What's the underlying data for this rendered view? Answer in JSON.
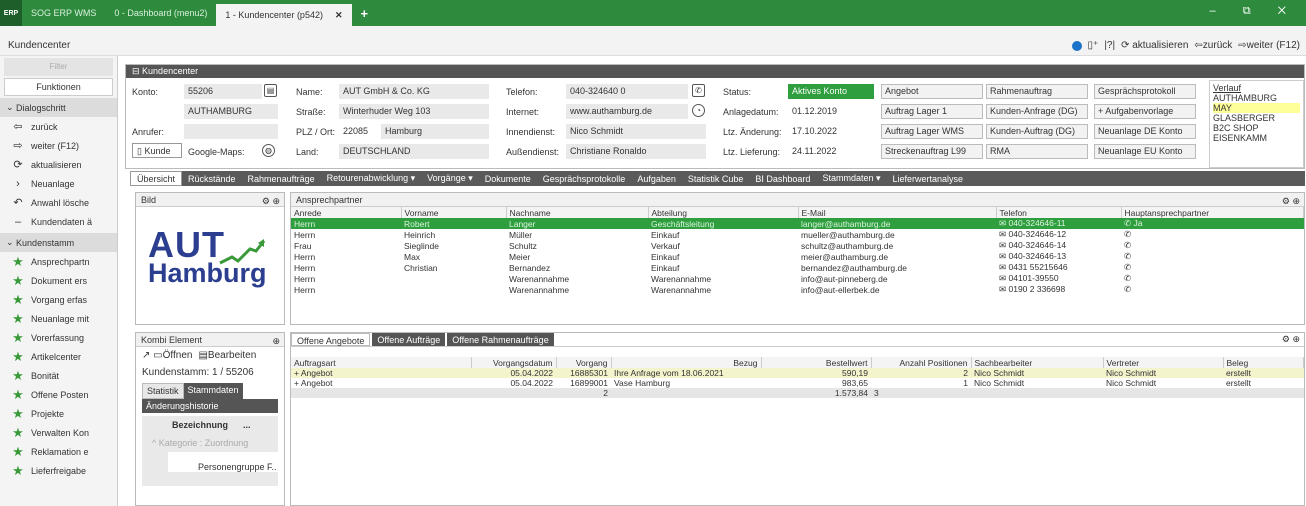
{
  "topbar": {
    "logo": "ERP",
    "tabs": [
      {
        "label": "SOG ERP WMS"
      },
      {
        "label": "0 - Dashboard (menu2)"
      }
    ],
    "active_tab": "1 - Kundencenter (p542)",
    "close": "✕",
    "plus": "+",
    "controls": "– ⧉ ✕"
  },
  "header": {
    "title": "Kundencenter",
    "refresh": "aktualisieren",
    "back": "zurück",
    "forward": "weiter (F12)"
  },
  "sidebar": {
    "filter": "Filter",
    "functions": "Funktionen",
    "sections": {
      "dialog": "Dialogschritt",
      "kunden": "Kundenstamm"
    },
    "dialog_items": [
      {
        "icon": "back-arrow-icon",
        "glyph": "⇦",
        "label": "zurück"
      },
      {
        "icon": "forward-arrow-icon",
        "glyph": "⇨",
        "label": "weiter (F12)"
      },
      {
        "icon": "refresh-icon",
        "glyph": "⟳",
        "label": "aktualisieren"
      },
      {
        "icon": "chevron-right-icon",
        "glyph": "›",
        "label": "Neuanlage"
      },
      {
        "icon": "delete-icon",
        "glyph": "↶",
        "label": "Anwahl lösche"
      },
      {
        "icon": "minus-icon",
        "glyph": "–",
        "label": "Kundendaten ä"
      }
    ],
    "kunden_items": [
      {
        "label": "Ansprechpartn"
      },
      {
        "label": "Dokument ers"
      },
      {
        "label": "Vorgang erfas"
      },
      {
        "label": "Neuanlage mit"
      },
      {
        "label": "Vorerfassung"
      },
      {
        "label": "Artikelcenter"
      },
      {
        "label": "Bonität"
      },
      {
        "label": "Offene Posten"
      },
      {
        "label": "Projekte"
      },
      {
        "label": "Verwalten Kon"
      },
      {
        "label": "Reklamation e"
      },
      {
        "label": "Lieferfreigabe"
      }
    ]
  },
  "kc": {
    "title": "Kundencenter",
    "konto_l": "Konto:",
    "konto": "55206",
    "matchcode": "AUTHAMBURG",
    "anrufer_l": "Anrufer:",
    "kunde_btn": "Kunde",
    "maps_l": "Google-Maps:",
    "name_l": "Name:",
    "name": "AUT GmbH & Co. KG",
    "strasse_l": "Straße:",
    "strasse": "Winterhuder Weg 103",
    "plz_l": "PLZ / Ort:",
    "plz": "22085",
    "ort": "Hamburg",
    "land_l": "Land:",
    "land": "DEUTSCHLAND",
    "tel_l": "Telefon:",
    "tel": "040-324640 0",
    "inet_l": "Internet:",
    "inet": "www.authamburg.de",
    "inn_l": "Innendienst:",
    "inn": "Nico Schmidt",
    "aus_l": "Außendienst:",
    "aus": "Christiane Ronaldo",
    "status_l": "Status:",
    "status": "Aktives Konto",
    "anl_l": "Anlagedatum:",
    "anl": "01.12.2019",
    "aend_l": "Ltz. Änderung:",
    "aend": "17.10.2022",
    "lief_l": "Ltz. Lieferung:",
    "lief": "24.11.2022",
    "buttons": [
      [
        "Angebot",
        "Rahmenauftrag",
        "Gesprächsprotokoll"
      ],
      [
        "Auftrag Lager 1",
        "Kunden-Anfrage (DG)",
        "+ Aufgabenvorlage"
      ],
      [
        "Auftrag Lager WMS",
        "Kunden-Auftrag (DG)",
        "Neuanlage DE Konto"
      ],
      [
        "Streckenauftrag L99",
        "RMA",
        "Neuanlage EU Konto"
      ]
    ],
    "verlauf": {
      "title": "Verlauf",
      "items": [
        "AUTHAMBURG",
        "MAY",
        "GLASBERGER",
        "B2C SHOP",
        "EISENKAMM"
      ]
    }
  },
  "navbar": [
    "Übersicht",
    "Rückstände",
    "Rahmenaufträge",
    "Retourenabwicklung ▾",
    "Vorgänge ▾",
    "Dokumente",
    "Gesprächsprotokolle",
    "Aufgaben",
    "Statistik Cube",
    "BI Dashboard",
    "Stammdaten ▾",
    "Lieferwertanalyse"
  ],
  "bild": {
    "title": "Bild",
    "aut": "AUT",
    "hamburg": "Hamburg"
  },
  "ap": {
    "title": "Ansprechpartner",
    "headers": [
      "Anrede",
      "Vorname",
      "Nachname",
      "Abteilung",
      "E-Mail",
      "Telefon",
      "Hauptansprechpartner"
    ],
    "rows": [
      [
        "Herrn",
        "Robert",
        "Langer",
        "Geschäftsleitung",
        "langer@authamburg.de",
        "040-324646-11",
        "Ja"
      ],
      [
        "Herrn",
        "Heinrich",
        "Müller",
        "Einkauf",
        "mueller@authamburg.de",
        "040-324646-12",
        ""
      ],
      [
        "Frau",
        "Sieglinde",
        "Schultz",
        "Verkauf",
        "schultz@authamburg.de",
        "040-324646-14",
        ""
      ],
      [
        "Herrn",
        "Max",
        "Meier",
        "Einkauf",
        "meier@authamburg.de",
        "040-324646-13",
        ""
      ],
      [
        "Herrn",
        "Christian",
        "Bernandez",
        "Einkauf",
        "bernandez@authamburg.de",
        "0431 55215646",
        ""
      ],
      [
        "Herrn",
        "",
        "Warenannahme",
        "Warenannahme",
        "info@aut-pinneberg.de",
        "04101-39550",
        ""
      ],
      [
        "Herrn",
        "",
        "Warenannahme",
        "Warenannahme",
        "info@aut-ellerbek.de",
        "0190 2 336698",
        ""
      ]
    ]
  },
  "kombi": {
    "title": "Kombi Element",
    "oeffnen": "Öffnen",
    "bearbeiten": "Bearbeiten",
    "stamm": "Kundenstamm: 1 / 55206",
    "tab1": "Statistik",
    "tab2": "Stammdaten",
    "sub": "Änderungshistorie",
    "bez": "Bezeichnung",
    "more": "...",
    "kat": "^ Kategorie : Zuordnung",
    "pers": "Personengruppe  F.."
  },
  "offene": {
    "tabs": [
      "Offene Angebote",
      "Offene Aufträge",
      "Offene Rahmenaufträge"
    ],
    "headers": [
      "Auftragsart",
      "Vorgangsdatum",
      "Vorgang",
      "Bezug",
      "Bestellwert",
      "Anzahl Positionen",
      "Sachbearbeiter",
      "Vertreter",
      "Beleg"
    ],
    "rows": [
      [
        "+ Angebot",
        "05.04.2022",
        "16885301",
        "Ihre Anfrage vom 18.06.2021",
        "590,19",
        "2",
        "Nico Schmidt",
        "Nico Schmidt",
        "erstellt"
      ],
      [
        "+ Angebot",
        "05.04.2022",
        "16899001",
        "Vase Hamburg",
        "983,65",
        "1",
        "Nico Schmidt",
        "Nico Schmidt",
        "erstellt"
      ]
    ],
    "sum": {
      "count": "2",
      "value": "1.573,84",
      "pos": "3"
    }
  }
}
